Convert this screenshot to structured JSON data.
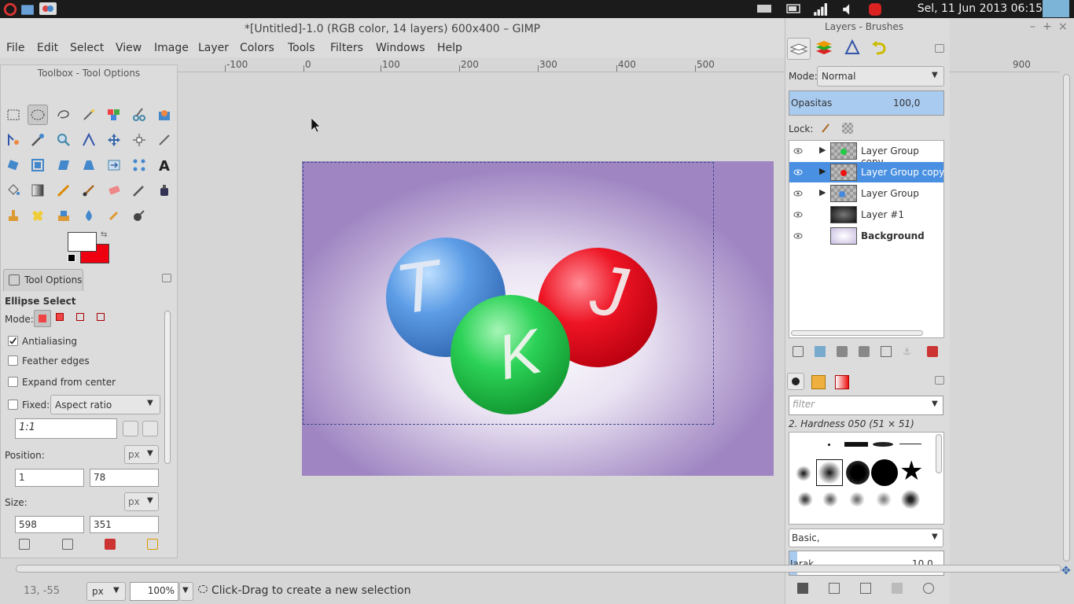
{
  "system_bar": {
    "clock": "Sel, 11 Jun 2013 06:15"
  },
  "window": {
    "title": "*[Untitled]-1.0 (RGB color, 14 layers) 600x400 – GIMP"
  },
  "menu": [
    "File",
    "Edit",
    "Select",
    "View",
    "Image",
    "Layer",
    "Colors",
    "Tools",
    "Filters",
    "Windows",
    "Help"
  ],
  "ruler": {
    "labels": [
      "-100",
      "0",
      "100",
      "200",
      "300",
      "400",
      "500",
      "900"
    ]
  },
  "toolbox": {
    "title": "Toolbox - Tool Options",
    "tool_options_tab": "Tool Options",
    "tool_name": "Ellipse Select",
    "mode_label": "Mode:",
    "antialiasing": "Antialiasing",
    "feather_edges": "Feather edges",
    "expand_from_center": "Expand from center",
    "fixed_label": "Fixed:",
    "fixed_value": "Aspect ratio",
    "ratio_value": "1:1",
    "position_label": "Position:",
    "position_unit": "px",
    "position_x": "1",
    "position_y": "78",
    "size_label": "Size:",
    "size_unit": "px",
    "size_w": "598",
    "size_h": "351"
  },
  "layers_panel": {
    "title": "Layers - Brushes",
    "mode_label": "Mode:",
    "mode_value": "Normal",
    "opacity_label": "Opasitas",
    "opacity_value": "100,0",
    "lock_label": "Lock:",
    "layers": [
      {
        "name": "Layer Group copy"
      },
      {
        "name": "Layer Group copy #"
      },
      {
        "name": "Layer Group"
      },
      {
        "name": "Layer #1"
      },
      {
        "name": "Background"
      }
    ]
  },
  "brushes_panel": {
    "filter_placeholder": "filter",
    "brush_name": "2. Hardness 050 (51 × 51)",
    "preset": "Basic,",
    "spacing_label": "Jarak",
    "spacing_value": "10,0"
  },
  "status": {
    "coords": "13, -55",
    "unit": "px",
    "zoom": "100%",
    "message": "Click-Drag to create a new selection"
  },
  "balls": {
    "letters": [
      "T",
      "K",
      "J"
    ],
    "colors": [
      "#4a8fe0",
      "#22c04a",
      "#e0101e"
    ]
  }
}
